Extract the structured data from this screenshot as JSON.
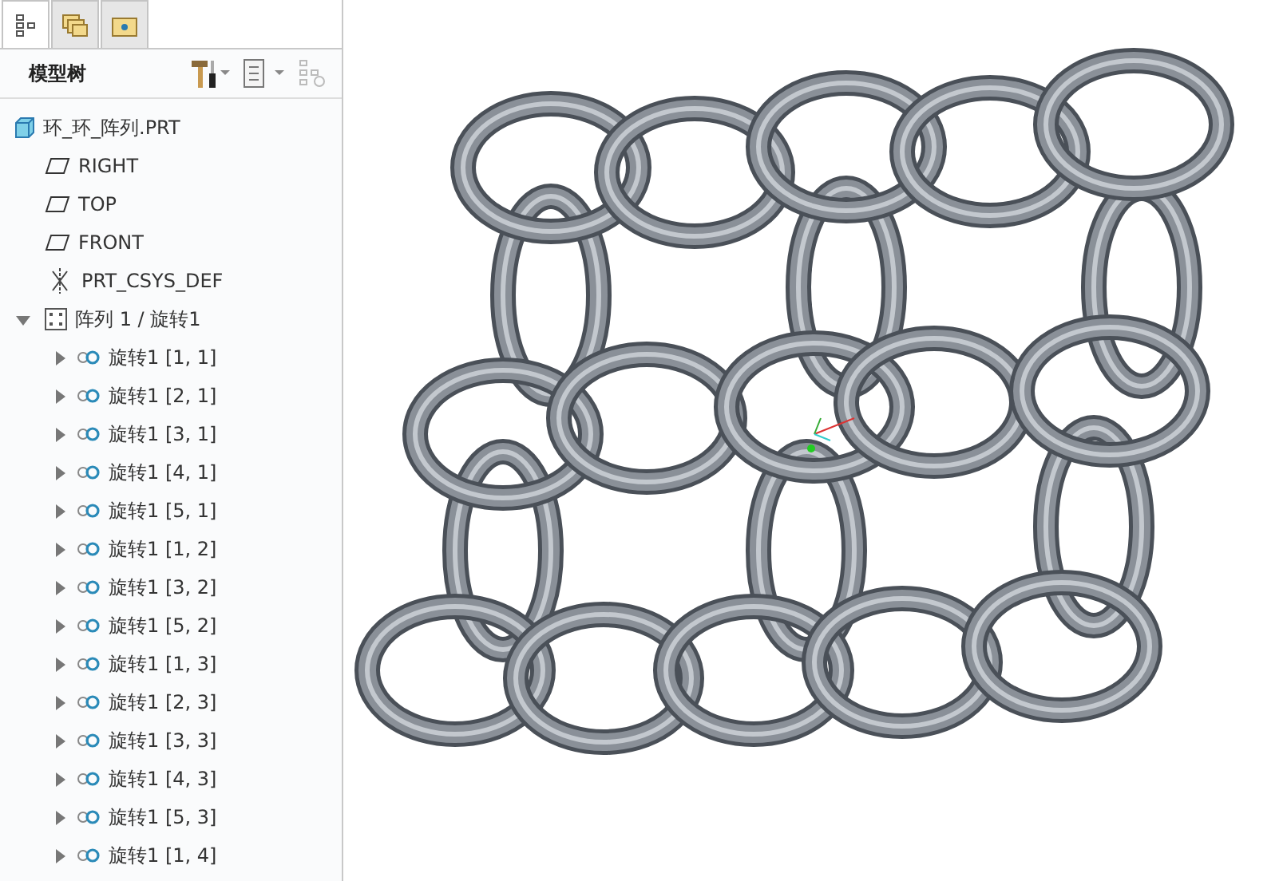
{
  "tabs": [
    {
      "kind": "tree",
      "selected": true
    },
    {
      "kind": "layers",
      "selected": false
    },
    {
      "kind": "folder",
      "selected": false
    }
  ],
  "panel_title": "模型树",
  "tree": [
    {
      "kind": "part",
      "label": "环_环_阵列.PRT"
    },
    {
      "kind": "plane",
      "label": "RIGHT"
    },
    {
      "kind": "plane",
      "label": "TOP"
    },
    {
      "kind": "plane",
      "label": "FRONT"
    },
    {
      "kind": "csys",
      "label": "PRT_CSYS_DEF"
    },
    {
      "kind": "pattern",
      "label": "阵列 1 / 旋转1",
      "expanded": true,
      "children": [
        {
          "kind": "revolve",
          "label": "旋转1 [1, 1]",
          "expanded": false
        },
        {
          "kind": "revolve",
          "label": "旋转1 [2, 1]",
          "expanded": false
        },
        {
          "kind": "revolve",
          "label": "旋转1 [3, 1]",
          "expanded": false
        },
        {
          "kind": "revolve",
          "label": "旋转1 [4, 1]",
          "expanded": false
        },
        {
          "kind": "revolve",
          "label": "旋转1 [5, 1]",
          "expanded": false
        },
        {
          "kind": "revolve",
          "label": "旋转1 [1, 2]",
          "expanded": false
        },
        {
          "kind": "revolve",
          "label": "旋转1 [3, 2]",
          "expanded": false
        },
        {
          "kind": "revolve",
          "label": "旋转1 [5, 2]",
          "expanded": false
        },
        {
          "kind": "revolve",
          "label": "旋转1 [1, 3]",
          "expanded": false
        },
        {
          "kind": "revolve",
          "label": "旋转1 [2, 3]",
          "expanded": false
        },
        {
          "kind": "revolve",
          "label": "旋转1 [3, 3]",
          "expanded": false
        },
        {
          "kind": "revolve",
          "label": "旋转1 [4, 3]",
          "expanded": false
        },
        {
          "kind": "revolve",
          "label": "旋转1 [5, 3]",
          "expanded": false
        },
        {
          "kind": "revolve",
          "label": "旋转1 [1, 4]",
          "expanded": false
        }
      ]
    }
  ]
}
